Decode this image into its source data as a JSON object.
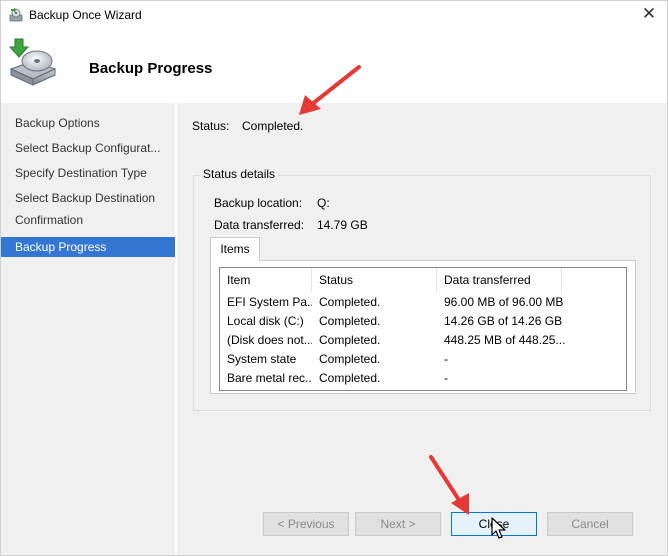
{
  "window": {
    "title": "Backup Once Wizard",
    "close_glyph": "✕"
  },
  "header": {
    "title": "Backup Progress",
    "icon": "backup-disk-icon"
  },
  "sidebar": {
    "items": [
      {
        "label": "Backup Options"
      },
      {
        "label": "Select Backup Configurat..."
      },
      {
        "label": "Specify Destination Type"
      },
      {
        "label": "Select Backup Destination"
      },
      {
        "label": "Confirmation"
      },
      {
        "label": "Backup Progress",
        "selected": true
      }
    ]
  },
  "status": {
    "label": "Status:",
    "value": "Completed."
  },
  "details": {
    "legend": "Status details",
    "location_label": "Backup location:",
    "location_value": "Q:",
    "transferred_label": "Data transferred:",
    "transferred_value": "14.79 GB",
    "tab_label": "Items",
    "columns": [
      "Item",
      "Status",
      "Data transferred"
    ],
    "rows": [
      {
        "item": "EFI System Pa...",
        "status": "Completed.",
        "data": "96.00 MB of 96.00 MB"
      },
      {
        "item": "Local disk (C:)",
        "status": "Completed.",
        "data": "14.26 GB of 14.26 GB"
      },
      {
        "item": "(Disk does not...",
        "status": "Completed.",
        "data": "448.25 MB of 448.25..."
      },
      {
        "item": "System state",
        "status": "Completed.",
        "data": "-"
      },
      {
        "item": "Bare metal rec...",
        "status": "Completed.",
        "data": "-"
      }
    ]
  },
  "buttons": {
    "previous": "< Previous",
    "next": "Next >",
    "close": "Close",
    "cancel": "Cancel"
  },
  "colors": {
    "selected_nav": "#3477d3",
    "annotation_arrow": "#e53935",
    "panel_bg": "#f0f0f0"
  }
}
